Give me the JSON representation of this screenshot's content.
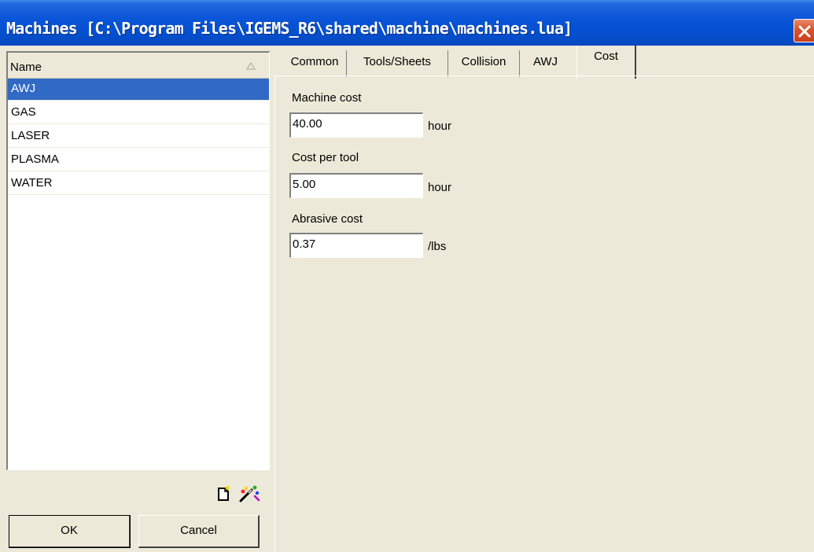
{
  "window": {
    "title": "Machines  [C:\\Program Files\\IGEMS_R6\\shared\\machine\\machines.lua]"
  },
  "machine_list": {
    "column_header": "Name",
    "items": [
      {
        "label": "AWJ",
        "selected": true
      },
      {
        "label": "GAS",
        "selected": false
      },
      {
        "label": "LASER",
        "selected": false
      },
      {
        "label": "PLASMA",
        "selected": false
      },
      {
        "label": "WATER",
        "selected": false
      }
    ]
  },
  "toolbar": {
    "icons": [
      "new-document-icon",
      "magic-wand-icon"
    ]
  },
  "buttons": {
    "ok": "OK",
    "cancel": "Cancel"
  },
  "tabs": [
    {
      "label": "Common",
      "active": false
    },
    {
      "label": "Tools/Sheets",
      "active": false
    },
    {
      "label": "Collision",
      "active": false
    },
    {
      "label": "AWJ",
      "active": false
    },
    {
      "label": "Cost",
      "active": true
    }
  ],
  "cost": {
    "machine_cost": {
      "label": "Machine cost",
      "value": "40.00",
      "unit": "hour"
    },
    "cost_per_tool": {
      "label": "Cost per tool",
      "value": "5.00",
      "unit": "hour"
    },
    "abrasive_cost": {
      "label": "Abrasive cost",
      "value": "0.37",
      "unit": "/lbs"
    }
  },
  "colors": {
    "title_bar": "#0a55d8",
    "selection": "#316ac5",
    "face": "#ece9d8",
    "close_button": "#d9532c"
  }
}
